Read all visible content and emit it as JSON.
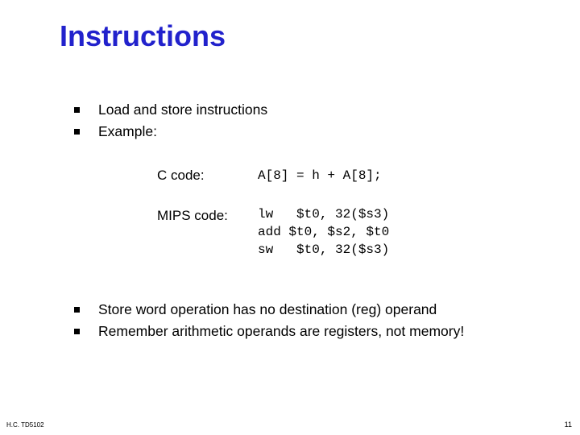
{
  "slide": {
    "title": "Instructions",
    "bullets_top": [
      "Load and store instructions",
      "Example:"
    ],
    "code": {
      "c_label": "C code:",
      "c_text": "A[8] = h + A[8];",
      "mips_label": "MIPS code:",
      "mips_lines": [
        "lw   $t0, 32($s3)",
        "add $t0, $s2, $t0",
        "sw   $t0, 32($s3)"
      ]
    },
    "bullets_bottom": [
      "Store word operation has no destination (reg) operand",
      "Remember arithmetic operands are registers, not memory!"
    ],
    "footer_left": "H.C. TD5102",
    "footer_right": "11"
  }
}
